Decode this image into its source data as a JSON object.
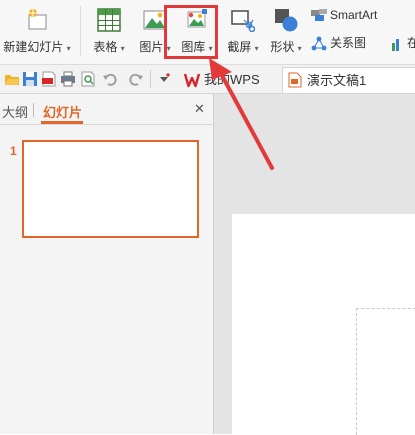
{
  "ribbon": {
    "new_slide": {
      "label": "新建幻灯片",
      "arrow": "▾"
    },
    "table": {
      "label": "表格",
      "arrow": "▾"
    },
    "picture": {
      "label": "图片",
      "arrow": "▾"
    },
    "gallery": {
      "label": "图库",
      "arrow": "▾"
    },
    "screenshot": {
      "label": "截屏",
      "arrow": "▾"
    },
    "shape": {
      "label": "形状",
      "arrow": "▾"
    },
    "smartart": {
      "label": "SmartArt"
    },
    "relation": {
      "label": "关系图"
    },
    "partial_label": "在"
  },
  "qat": {
    "tab_wps": "我的WPS",
    "tab_doc": "演示文稿1"
  },
  "panel": {
    "tab_outline": "大纲",
    "tab_slides": "幻灯片",
    "close": "✕",
    "slide_number": "1"
  },
  "colors": {
    "accent_orange": "#e0662a",
    "highlight_red": "#e23a3a",
    "wps_red": "#d9242a"
  }
}
